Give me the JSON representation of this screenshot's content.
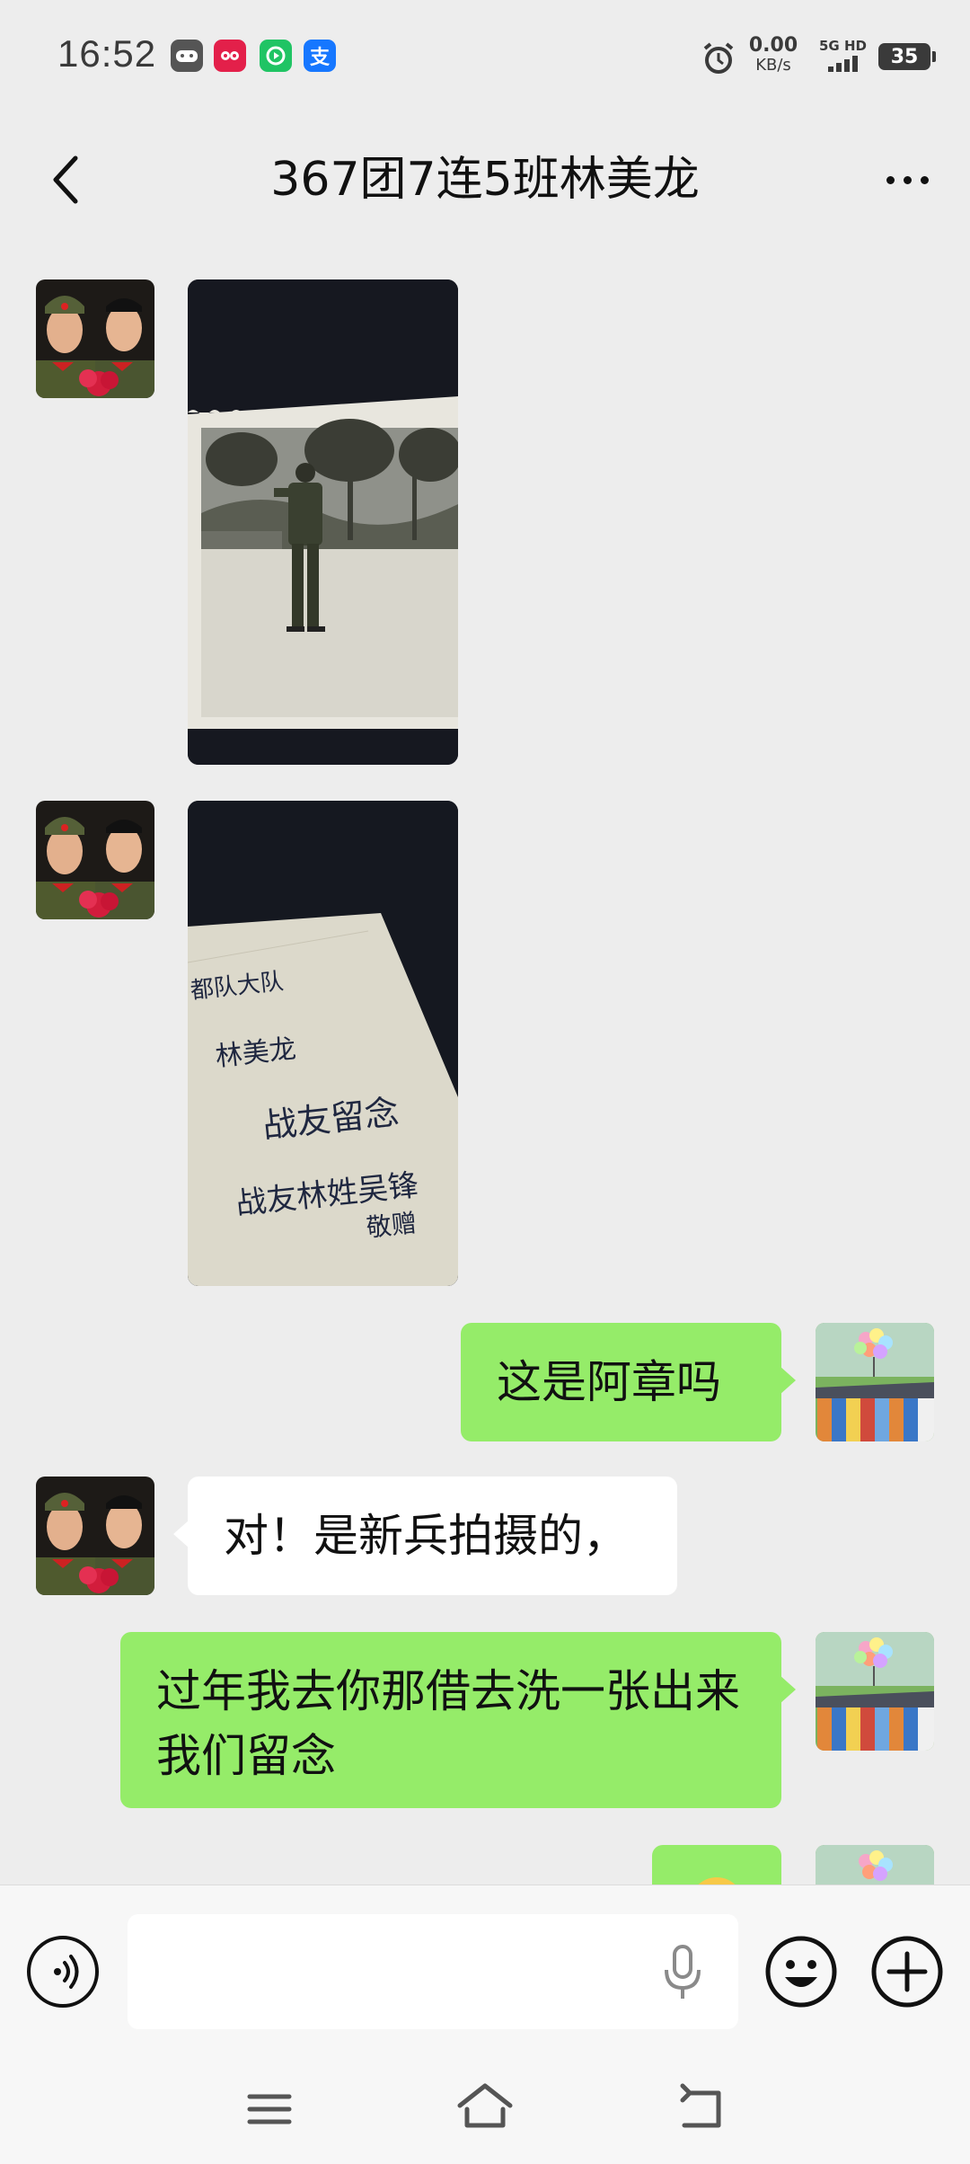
{
  "status_bar": {
    "time": "16:52",
    "app_icons": [
      "gamepad-icon",
      "xiaohongshu-icon",
      "iqiyi-icon",
      "alipay-icon"
    ],
    "alipay_glyph": "支",
    "net_speed": "0.00",
    "net_speed_unit": "KB/s",
    "signal_label": "5G HD",
    "battery": "35"
  },
  "header": {
    "title": "367团7连5班林美龙"
  },
  "photo_note": {
    "line1": "都队大队",
    "line2": "林美龙",
    "line3": "战友留念",
    "line4": "战友林姓吴锋",
    "line5": "敬赠"
  },
  "messages": [
    {
      "side": "left",
      "type": "image",
      "content": "soldier-photo"
    },
    {
      "side": "left",
      "type": "image",
      "content": "handwritten-note-photo"
    },
    {
      "side": "right",
      "type": "text",
      "text": "这是阿章吗"
    },
    {
      "side": "left",
      "type": "text",
      "text": "对！是新兵拍摄的，"
    },
    {
      "side": "right",
      "type": "text",
      "text": "过年我去你那借去洗一张出来我们留念"
    },
    {
      "side": "right",
      "type": "emoji",
      "content": "emoji-partial"
    }
  ],
  "input_bar": {
    "placeholder": "",
    "value": ""
  },
  "colors": {
    "background": "#ededed",
    "outgoing_bubble": "#95ec69",
    "incoming_bubble": "#ffffff"
  }
}
